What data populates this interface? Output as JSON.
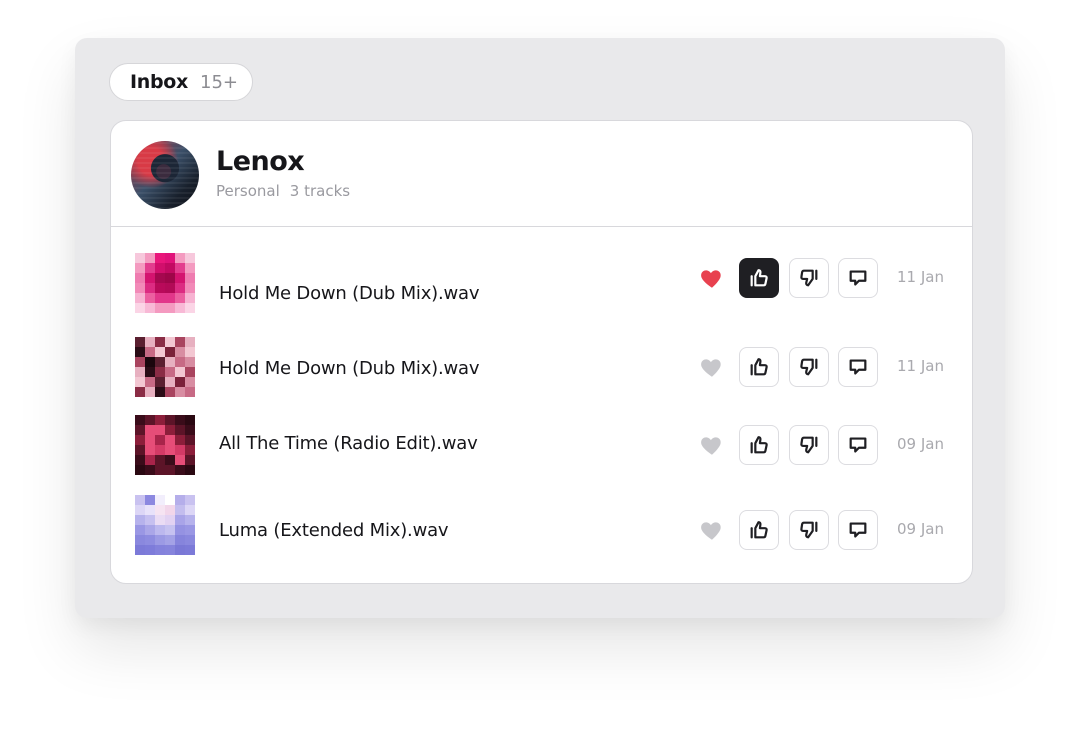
{
  "inbox": {
    "label": "Inbox",
    "count": "15+"
  },
  "playlist": {
    "name": "Lenox",
    "type": "Personal",
    "track_count": "3 tracks"
  },
  "colors": {
    "liked": "#e8414f",
    "unliked": "#c7c7cb",
    "active_button": "#1f1f23"
  },
  "icons": {
    "heart": "heart-icon",
    "like": "thumbs-up-icon",
    "dislike": "thumbs-down-icon",
    "comment": "comment-icon"
  },
  "tracks": [
    {
      "title": "Hold Me Down (Dub Mix).wav",
      "date": "11 Jan",
      "liked": true,
      "thumbs_up_active": true,
      "thumb_colors": [
        "#f7c8dc",
        "#f49ac0",
        "#e9167b",
        "#e0127a",
        "#f49ac0",
        "#f7c8dc",
        "#f49ac0",
        "#e33c8e",
        "#d10f6c",
        "#c20a62",
        "#e33c8e",
        "#f49ac0",
        "#ef7cb0",
        "#d4136f",
        "#a5084f",
        "#9e0649",
        "#d4136f",
        "#ef7cb0",
        "#f28ab8",
        "#dc2b82",
        "#b90a5a",
        "#b30a57",
        "#dc2b82",
        "#f28ab8",
        "#f7b3d2",
        "#ec5fa0",
        "#e2368a",
        "#e2368a",
        "#ec5fa0",
        "#f7b3d2",
        "#fbd5e6",
        "#f8b9d6",
        "#f49ac0",
        "#f49ac0",
        "#f8b9d6",
        "#fbd5e6"
      ]
    },
    {
      "title": "Hold Me Down (Dub Mix).wav",
      "date": "11 Jan",
      "liked": false,
      "thumbs_up_active": false,
      "thumb_colors": [
        "#5a1f30",
        "#e7b0c0",
        "#8a2c45",
        "#f3c7d2",
        "#a9445f",
        "#e7b0c0",
        "#2a0c16",
        "#c76a85",
        "#f3c7d2",
        "#7a2139",
        "#d88da2",
        "#f3c7d2",
        "#a9445f",
        "#1a060d",
        "#5a1f30",
        "#e7b0c0",
        "#c76a85",
        "#d88da2",
        "#e7b0c0",
        "#2a0c16",
        "#8a2c45",
        "#c76a85",
        "#f3c7d2",
        "#a9445f",
        "#f3c7d2",
        "#c76a85",
        "#5a1f30",
        "#e7b0c0",
        "#7a2139",
        "#d88da2",
        "#8a2c45",
        "#e7b0c0",
        "#2a0c16",
        "#a9445f",
        "#d88da2",
        "#c76a85"
      ]
    },
    {
      "title": "All The Time (Radio Edit).wav",
      "date": "09 Jan",
      "liked": false,
      "thumbs_up_active": false,
      "thumb_colors": [
        "#3a0c1a",
        "#5c1428",
        "#8c1e3a",
        "#5c1428",
        "#3a0c1a",
        "#2a0812",
        "#5c1428",
        "#e64d78",
        "#e64d78",
        "#8c1e3a",
        "#5c1428",
        "#3a0c1a",
        "#8c1e3a",
        "#e64d78",
        "#a8244a",
        "#e64d78",
        "#8c1e3a",
        "#5c1428",
        "#5c1428",
        "#e64d78",
        "#d43a66",
        "#e64d78",
        "#d43a66",
        "#8c1e3a",
        "#3a0c1a",
        "#a8244a",
        "#5c1428",
        "#3a0c1a",
        "#e64d78",
        "#5c1428",
        "#2a0812",
        "#3a0c1a",
        "#5c1428",
        "#5c1428",
        "#3a0c1a",
        "#2a0812"
      ]
    },
    {
      "title": "Luma (Extended Mix).wav",
      "date": "09 Jan",
      "liked": false,
      "thumbs_up_active": false,
      "thumb_colors": [
        "#c9c2f0",
        "#8c88e0",
        "#f2eefc",
        "#ffffff",
        "#b5aeea",
        "#c9c2f0",
        "#dcd6f6",
        "#e8e2fa",
        "#f6e4f2",
        "#f2d6ea",
        "#c3bdee",
        "#dcd6f6",
        "#b6b2ec",
        "#c6c0f0",
        "#eadcf4",
        "#e2d2f2",
        "#a9a4e8",
        "#b6b2ec",
        "#9a97e4",
        "#aaa6e8",
        "#bcb8ee",
        "#c6c2f0",
        "#9592e2",
        "#9a97e4",
        "#8a88de",
        "#8e8ce0",
        "#9c9ae4",
        "#a4a2e6",
        "#8684dc",
        "#8a88de",
        "#7c7ad8",
        "#7e7cda",
        "#8482dc",
        "#8684dc",
        "#7a78d6",
        "#7c7ad8"
      ]
    }
  ]
}
